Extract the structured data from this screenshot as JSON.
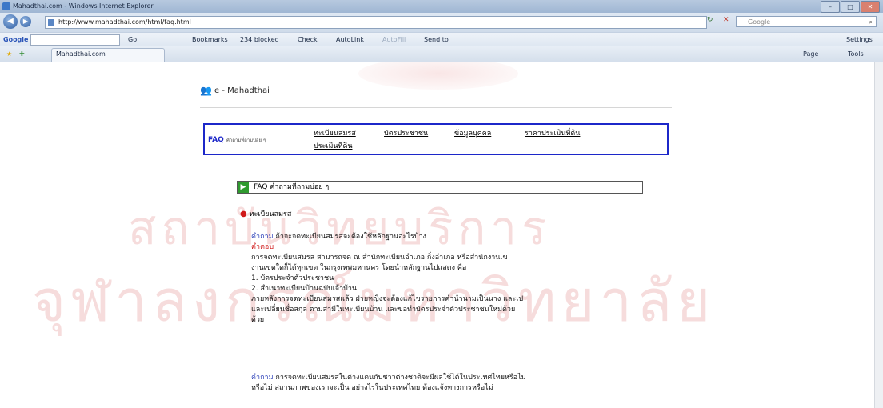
{
  "window": {
    "title": "Mahadthai.com - Windows Internet Explorer"
  },
  "address_bar": {
    "url": "http://www.mahadthai.com/html/faq.html",
    "search_placeholder": "Google"
  },
  "google_toolbar": {
    "label": "Google",
    "items": [
      "Go",
      "Bookmarks",
      "234 blocked",
      "Check",
      "AutoLink",
      "AutoFill",
      "Send to"
    ],
    "settings": "Settings"
  },
  "favorites_bar": {
    "tab_title": "Mahadthai.com",
    "tools": [
      "Page",
      "Tools"
    ]
  },
  "watermark": {
    "line1": "สถาบันวิทยบริการ",
    "line2": "จุฬาลงกรณ์มหาวิทยาลัย"
  },
  "site": {
    "brand": "e - Mahadthai",
    "nav": {
      "faq_label": "FAQ",
      "faq_sub": "คำถามที่ถามบ่อย ๆ",
      "links": [
        "ทะเบียนสมรส",
        "บัตรประชาชน",
        "ข้อมูลบุคคล",
        "ราคาประเมินที่ดิน",
        "ประเมินที่ดิน"
      ]
    },
    "faq_header": "FAQ  คำถามที่ถามบ่อย ๆ",
    "section": "ทะเบียนสมรส",
    "qa": [
      {
        "q_label": "คำถาม",
        "question": "ถ้าจะจดทะเบียนสมรสจะต้องใช้หลักฐานอะไรบ้าง",
        "a_label": "คำตอบ",
        "answer": [
          "การจดทะเบียนสมรส สามารถจด ณ สำนักทะเบียนอำเภอ กิ่งอำเภอ หรือสำนักงานเข",
          "งานเขตใดก็ได้ทุกเขต ในกรุงเทพมหานคร โดยนำหลักฐานไปแสดง คือ",
          "1. บัตรประจำตัวประชาชน",
          "2. สำเนาทะเบียนบ้านฉบับเจ้าบ้าน",
          "ภายหลังการจดทะเบียนสมรสแล้ว ฝ่ายหญิงจะต้องแก้ไขรายการคำนำนามเป็นนาง และเป",
          "และเปลี่ยนชื่อสกุล ตามสามีในทะเบียนบ้าน และขอทำบัตรประจำตัวประชาชนใหม่ด้วย",
          "ด้วย"
        ]
      },
      {
        "q_label": "คำถาม",
        "question": "การจดทะเบียนสมรสในต่างแดนกับชาวต่างชาติจะมีผลใช้ได้ในประเทศไทยหรือไม่",
        "answer": [
          "หรือไม่ สถานภาพของเราจะเป็น อย่างไรในประเทศไทย ต้องแจ้งทางการหรือไม่"
        ]
      }
    ]
  }
}
